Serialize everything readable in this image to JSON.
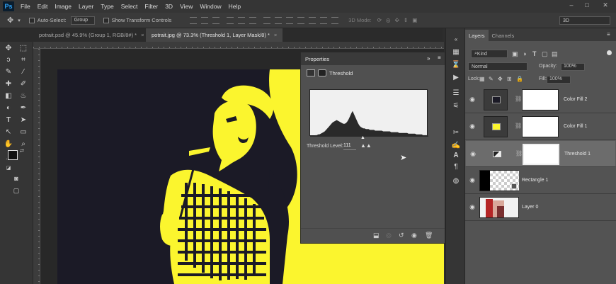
{
  "app": {
    "logo": "Ps"
  },
  "menu": [
    "File",
    "Edit",
    "Image",
    "Layer",
    "Type",
    "Select",
    "Filter",
    "3D",
    "View",
    "Window",
    "Help"
  ],
  "window_controls": {
    "minimize": "–",
    "maximize": "□",
    "close": "✕"
  },
  "options_bar": {
    "auto_select_label": "Auto-Select:",
    "auto_select_value": "Group",
    "show_transform_label": "Show Transform Controls",
    "mode_3d_label": "3D Mode:",
    "workspace_value": "3D"
  },
  "doc_tabs": [
    {
      "label": "potrait.psd @ 45.9% (Group 1, RGB/8#) *",
      "close": "×"
    },
    {
      "label": "potrait.jpg @ 73.3% (Threshold 1, Layer Mask/8) *",
      "close": "×"
    }
  ],
  "properties": {
    "title": "Properties",
    "panel_menu": "»",
    "adjustment_name": "Threshold",
    "threshold_label": "Threshold Level:",
    "threshold_value": "111",
    "histogram": [
      1,
      1,
      1,
      1,
      2,
      2,
      3,
      3,
      4,
      5,
      6,
      7,
      9,
      11,
      13,
      15,
      17,
      19,
      20,
      21,
      22,
      21,
      20,
      19,
      18,
      17,
      17,
      18,
      20,
      23,
      27,
      31,
      34,
      30,
      26,
      22,
      18,
      15,
      13,
      12,
      11,
      11,
      10,
      10,
      10,
      9,
      9,
      9,
      9,
      8,
      8,
      8,
      8,
      8,
      8,
      7,
      7,
      7,
      7,
      7,
      7,
      6,
      6,
      6,
      6,
      6,
      6,
      5,
      5,
      5,
      5,
      5,
      5,
      5,
      4,
      4,
      4,
      4,
      4,
      4,
      3,
      3,
      3,
      3,
      3,
      2,
      2,
      2,
      2,
      1
    ]
  },
  "layers_panel": {
    "tabs": [
      "Layers",
      "Channels"
    ],
    "filter_kind": "Kind",
    "blend_mode": "Normal",
    "opacity_label": "Opacity:",
    "opacity_value": "100%",
    "lock_label": "Lock:",
    "fill_label": "Fill:",
    "fill_value": "100%",
    "layers": [
      {
        "name": "Color Fill 2"
      },
      {
        "name": "Color Fill 1"
      },
      {
        "name": "Threshold 1"
      },
      {
        "name": "Rectangle 1"
      },
      {
        "name": "Layer 0"
      }
    ]
  },
  "colors": {
    "yellow": "#fbf52e",
    "dark": "#1b1a26",
    "accent": "#2fa3f7"
  }
}
